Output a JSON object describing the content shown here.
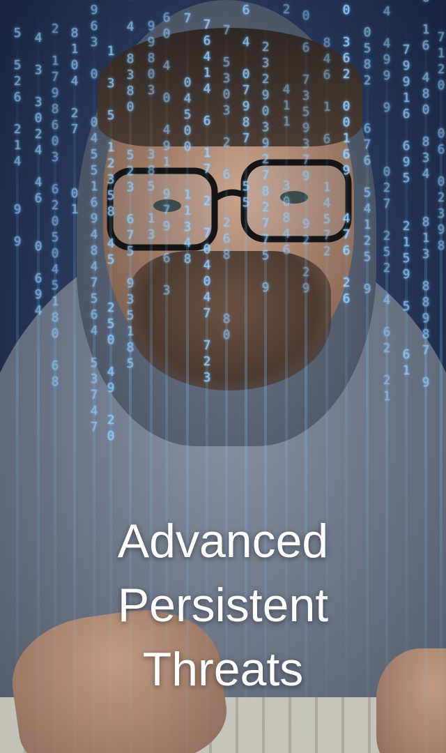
{
  "poster": {
    "title_lines": [
      "Advanced",
      "Persistent",
      "Threats"
    ]
  },
  "image": {
    "subject": "hacker-portrait-icon",
    "accent_color": "#9fd4ff"
  }
}
